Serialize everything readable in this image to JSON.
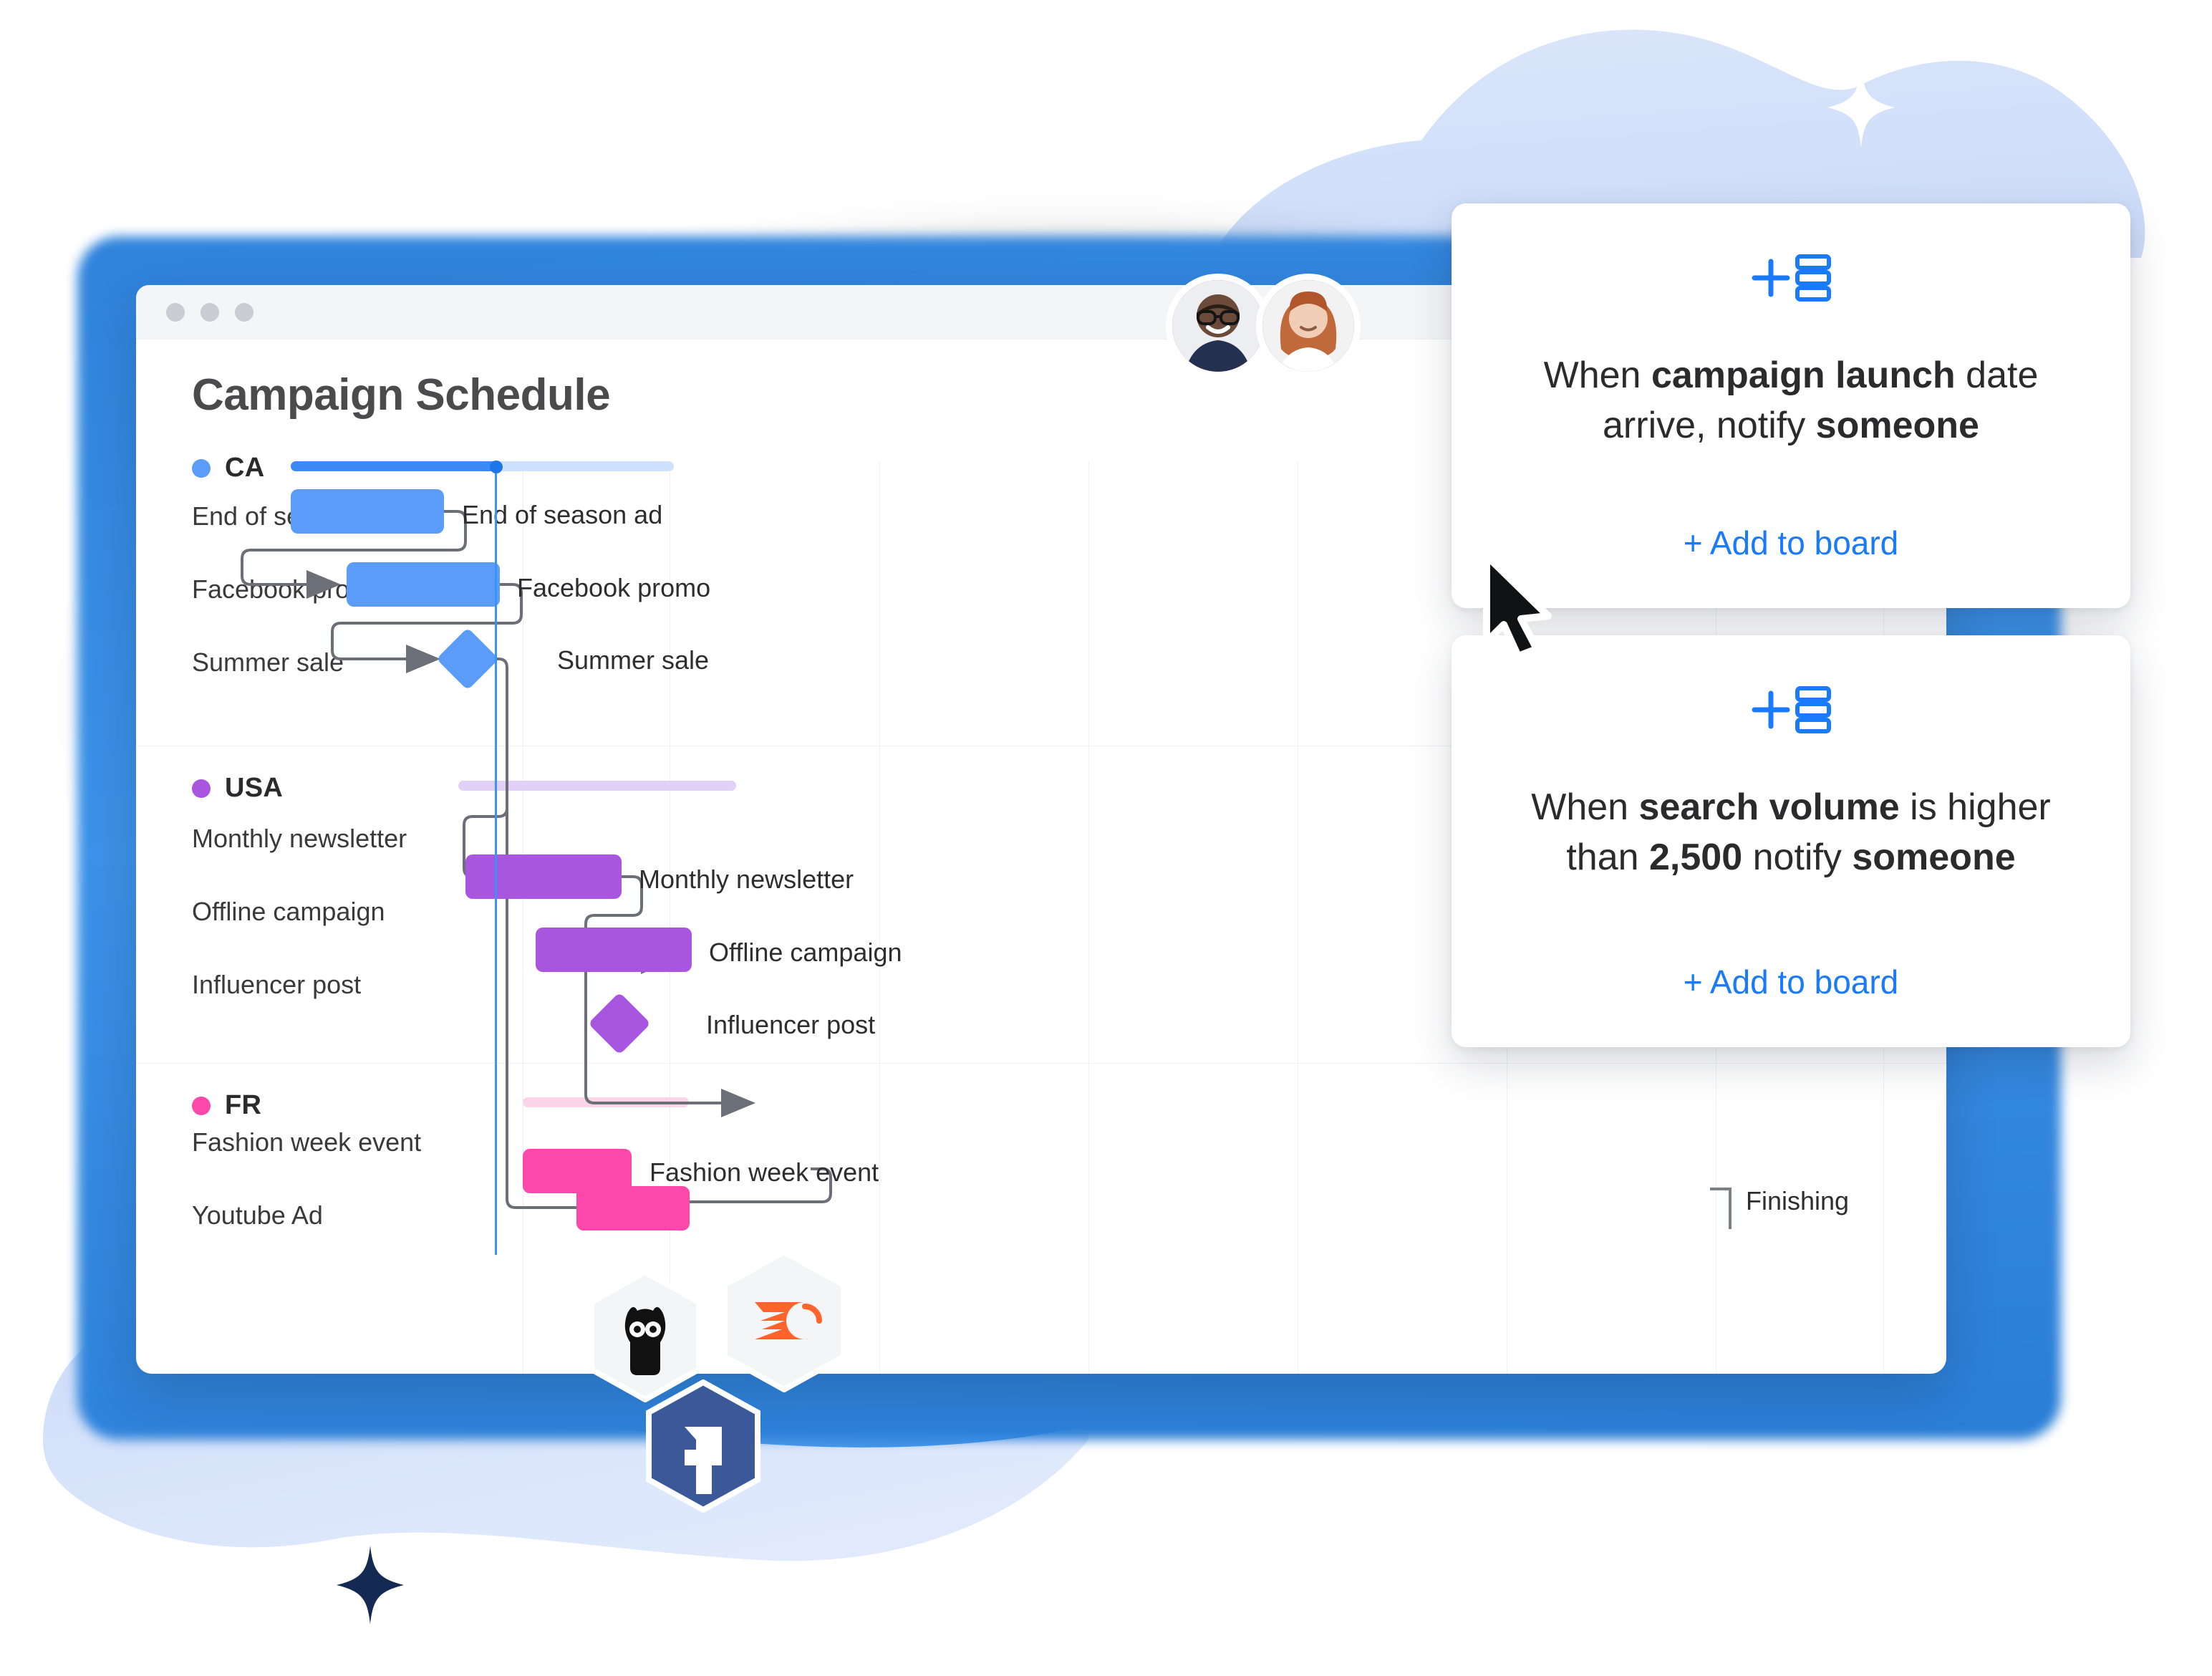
{
  "window": {
    "title": "Campaign Schedule",
    "traffic_lights": [
      "close",
      "minimize",
      "maximize"
    ]
  },
  "gantt": {
    "groups": [
      {
        "name": "CA",
        "color": "#5b9cf8",
        "track_color": "#cfe2fd",
        "track_done_color": "#3b8af5",
        "tasks": [
          {
            "label": "End of season ad",
            "caption": "End of season ad",
            "type": "bar"
          },
          {
            "label": "Facebook promo",
            "caption": "Facebook promo",
            "type": "bar"
          },
          {
            "label": "Summer sale",
            "caption": "Summer sale",
            "type": "milestone"
          }
        ]
      },
      {
        "name": "USA",
        "color": "#a855e0",
        "track_color": "#e3d0f6",
        "track_done_color": "#e3d0f6",
        "tasks": [
          {
            "label": "Monthly newsletter",
            "caption": "Monthly newsletter",
            "type": "bar"
          },
          {
            "label": "Offline campaign",
            "caption": "Offline campaign",
            "type": "bar"
          },
          {
            "label": "Influencer post",
            "caption": "Influencer post",
            "type": "milestone"
          }
        ]
      },
      {
        "name": "FR",
        "color": "#fc47ab",
        "track_color": "#fcd4e8",
        "track_done_color": "#fcd4e8",
        "tasks": [
          {
            "label": "Fashion week event",
            "caption": "Fashion week event",
            "type": "bar"
          },
          {
            "label": "Youtube Ad",
            "caption": "",
            "type": "bar"
          }
        ]
      }
    ],
    "finishing_label": "Finishing",
    "today_marker": "today"
  },
  "automations": [
    {
      "icon": "add-to-board-icon",
      "text_parts": [
        {
          "t": "When ",
          "b": false
        },
        {
          "t": "campaign launch",
          "b": true
        },
        {
          "t": " date arrive, notify ",
          "b": false
        },
        {
          "t": "someone",
          "b": true
        }
      ],
      "cta": "+ Add to board"
    },
    {
      "icon": "add-to-board-icon",
      "text_parts": [
        {
          "t": "When ",
          "b": false
        },
        {
          "t": "search volume",
          "b": true
        },
        {
          "t": " is higher than ",
          "b": false
        },
        {
          "t": "2,500",
          "b": true
        },
        {
          "t": " notify ",
          "b": false
        },
        {
          "t": "someone",
          "b": true
        }
      ],
      "cta": "+ Add to board"
    }
  ],
  "collaborators": [
    {
      "name": "avatar-man",
      "ring_color": "#ee2b62"
    },
    {
      "name": "avatar-woman",
      "ring_color": "#5b4ddb"
    }
  ],
  "integrations": [
    {
      "name": "hootsuite-icon",
      "bg": "#f4f5f7"
    },
    {
      "name": "semrush-icon",
      "bg": "#f4f5f7"
    },
    {
      "name": "facebook-icon",
      "bg": "#3b5998"
    }
  ],
  "colors": {
    "accent_blue": "#1a7afc",
    "ca": "#5b9cf8",
    "usa": "#a855e0",
    "fr": "#fc47ab",
    "text_dark": "#2b2b2e",
    "device_blue": "#3d92e8"
  }
}
